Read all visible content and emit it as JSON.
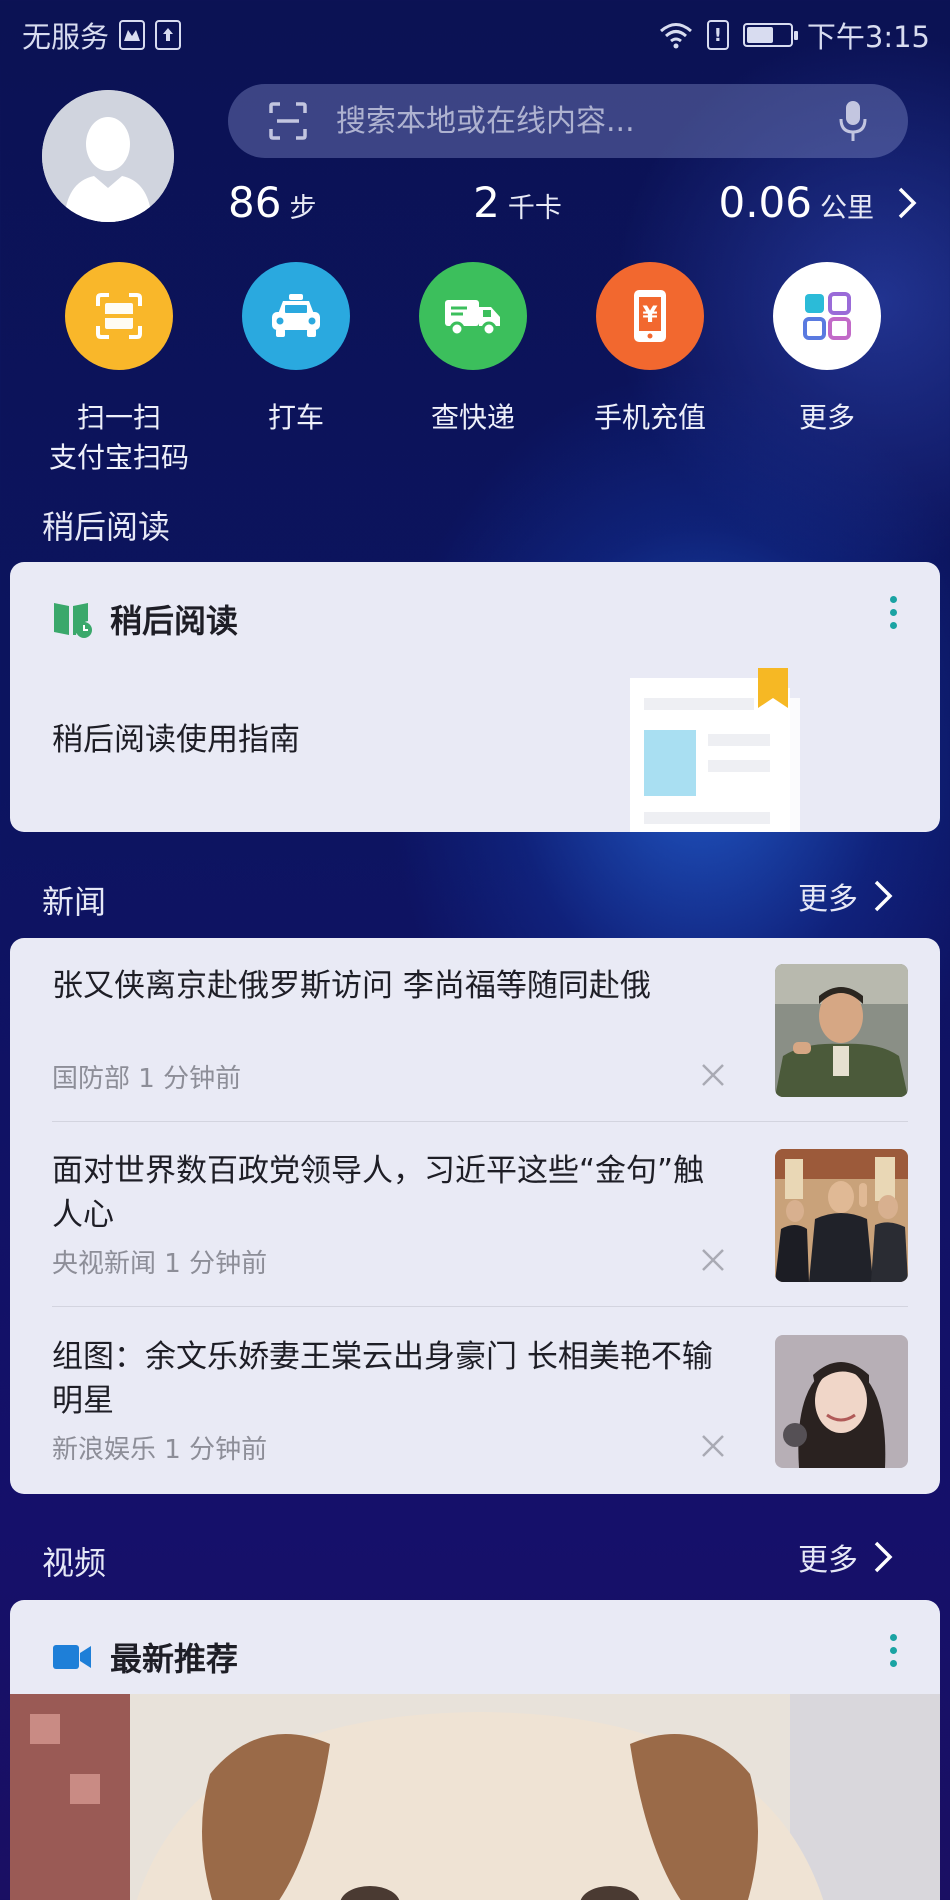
{
  "status_bar": {
    "carrier": "无服务",
    "time": "下午3:15",
    "battery_level": 0.58
  },
  "search": {
    "placeholder": "搜索本地或在线内容..."
  },
  "stats": {
    "steps_value": "86",
    "steps_unit": "步",
    "calories_value": "2",
    "calories_unit": "千卡",
    "distance_value": "0.06",
    "distance_unit": "公里"
  },
  "quick_actions": [
    {
      "label": "扫一扫\n支付宝扫码",
      "line1": "扫一扫",
      "line2": "支付宝扫码",
      "icon": "scan-icon",
      "color": "#f9b72a"
    },
    {
      "label": "打车",
      "line1": "打车",
      "icon": "taxi-icon",
      "color": "#2aa9df"
    },
    {
      "label": "查快递",
      "line1": "查快递",
      "icon": "delivery-truck-icon",
      "color": "#3cbf5c"
    },
    {
      "label": "手机充值",
      "line1": "手机充值",
      "icon": "phone-recharge-icon",
      "color": "#f2682f"
    },
    {
      "label": "更多",
      "line1": "更多",
      "icon": "apps-grid-icon",
      "color": "#ffffff"
    }
  ],
  "read_later": {
    "section_title": "稍后阅读",
    "card_title": "稍后阅读",
    "guide_text": "稍后阅读使用指南"
  },
  "news": {
    "section_title": "新闻",
    "more_label": "更多",
    "items": [
      {
        "title": "张又侠离京赴俄罗斯访问 李尚福等随同赴俄",
        "source": "国防部",
        "time": "1 分钟前",
        "meta": "国防部 1 分钟前"
      },
      {
        "title": "面对世界数百政党领导人，习近平这些“金句”触人心",
        "source": "央视新闻",
        "time": "1 分钟前",
        "meta": "央视新闻 1 分钟前"
      },
      {
        "title": "组图：余文乐娇妻王棠云出身豪门 长相美艳不输明星",
        "source": "新浪娱乐",
        "time": "1 分钟前",
        "meta": "新浪娱乐 1 分钟前"
      }
    ]
  },
  "video": {
    "section_title": "视频",
    "more_label": "更多",
    "card_title": "最新推荐"
  },
  "colors": {
    "accent_teal": "#1aa3a3",
    "video_icon_blue": "#1e7fd8",
    "book_icon_green": "#3aa86b"
  }
}
